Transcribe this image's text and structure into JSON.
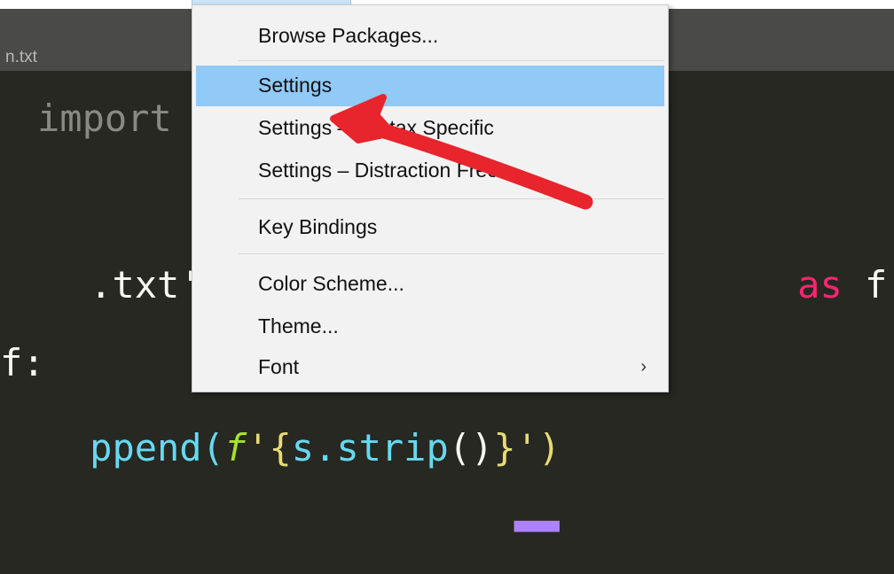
{
  "tab": {
    "label": "n.txt"
  },
  "code": {
    "line1": "import",
    "line2_str": ".txt',",
    "line2_as": "as",
    "line2_f": " f:",
    "line3": "f:",
    "line4_a": "ppend(",
    "line4_f": "f",
    "line4_b": "'{",
    "line4_c": "s.strip",
    "line4_d": "()",
    "line4_e": "}')"
  },
  "menu": {
    "items": [
      {
        "label": "Browse Packages..."
      },
      {
        "label": "Settings"
      },
      {
        "label": "Settings – Syntax Specific"
      },
      {
        "label": "Settings – Distraction Free"
      },
      {
        "label": "Key Bindings"
      },
      {
        "label": "Color Scheme..."
      },
      {
        "label": "Theme..."
      },
      {
        "label": "Font",
        "submenu_icon": "chevron-right-icon",
        "arrow": "›"
      }
    ],
    "highlighted_index": 1
  },
  "annotation": {
    "color": "#e8242c",
    "shape": "hand-drawn-arrow"
  }
}
